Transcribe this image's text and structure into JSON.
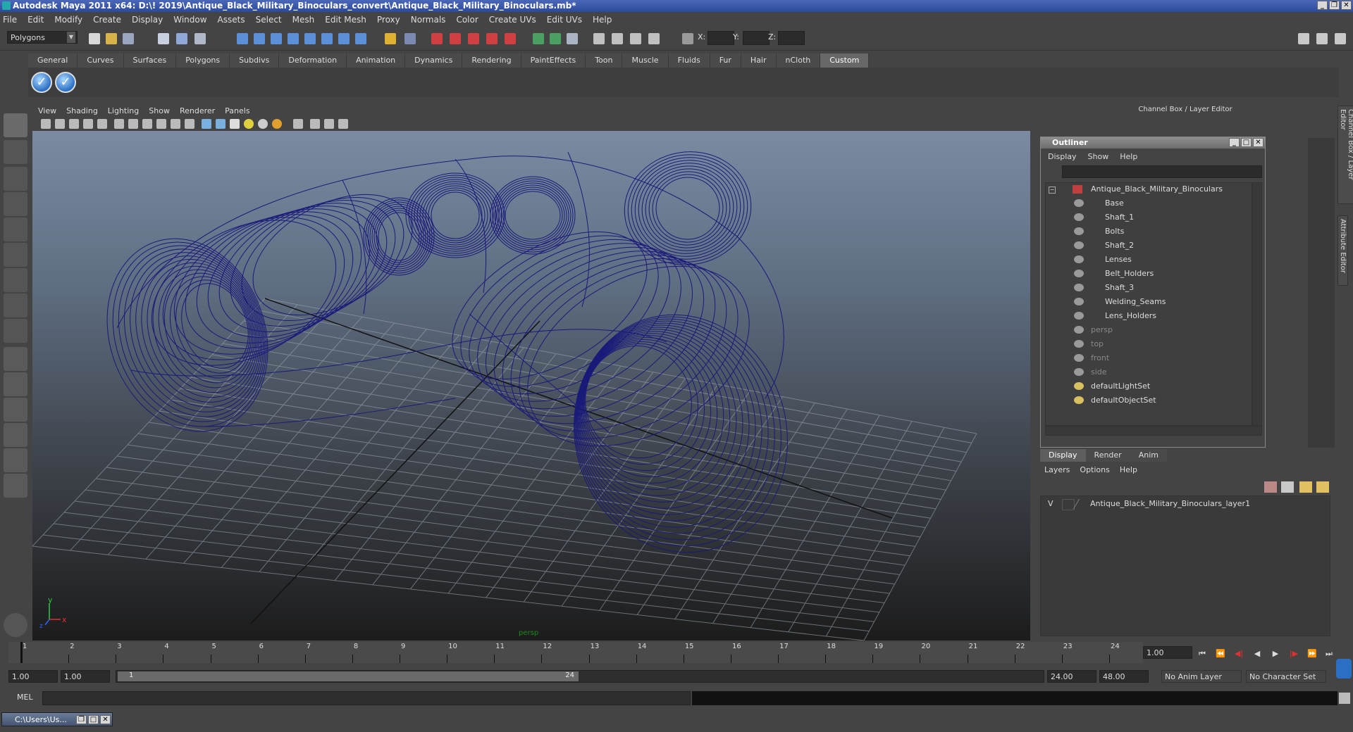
{
  "window": {
    "title": "Autodesk Maya 2011 x64: D:\\! 2019\\Antique_Black_Military_Binoculars_convert\\Antique_Black_Military_Binoculars.mb*"
  },
  "menubar": [
    "File",
    "Edit",
    "Modify",
    "Create",
    "Display",
    "Window",
    "Assets",
    "Select",
    "Mesh",
    "Edit Mesh",
    "Proxy",
    "Normals",
    "Color",
    "Create UVs",
    "Edit UVs",
    "Help"
  ],
  "statusline": {
    "mode": "Polygons",
    "x_label": "X:",
    "y_label": "Y:",
    "z_label": "Z:"
  },
  "shelf": {
    "tabs": [
      "General",
      "Curves",
      "Surfaces",
      "Polygons",
      "Subdivs",
      "Deformation",
      "Animation",
      "Dynamics",
      "Rendering",
      "PaintEffects",
      "Toon",
      "Muscle",
      "Fluids",
      "Fur",
      "Hair",
      "nCloth",
      "Custom"
    ],
    "active_tab": "Custom"
  },
  "viewport": {
    "menu": [
      "View",
      "Shading",
      "Lighting",
      "Show",
      "Renderer",
      "Panels"
    ],
    "camera_label": "persp",
    "axis_y": "y",
    "axis_x": "x",
    "axis_z": "z",
    "wire_color": "#1a1a7a"
  },
  "channelbox": {
    "title": "Channel Box / Layer Editor"
  },
  "vertical_tabs": [
    "Channel Box / Layer Editor",
    "Attribute Editor"
  ],
  "outliner": {
    "title": "Outliner",
    "menu": [
      "Display",
      "Show",
      "Help"
    ],
    "root": "Antique_Black_Military_Binoculars",
    "children": [
      "Base",
      "Shaft_1",
      "Bolts",
      "Shaft_2",
      "Lenses",
      "Belt_Holders",
      "Shaft_3",
      "Welding_Seams",
      "Lens_Holders"
    ],
    "cameras": [
      "persp",
      "top",
      "front",
      "side"
    ],
    "sets": [
      "defaultLightSet",
      "defaultObjectSet"
    ]
  },
  "layer_editor": {
    "tabs": [
      "Display",
      "Render",
      "Anim"
    ],
    "active_tab": "Display",
    "menu": [
      "Layers",
      "Options",
      "Help"
    ],
    "layer_visible": "V",
    "layer_name": "Antique_Black_Military_Binoculars_layer1"
  },
  "timeslider": {
    "start": 1,
    "end": 24,
    "current_frame": "1.00"
  },
  "range": {
    "start_time": "1.00",
    "playback_start": "1.00",
    "range_start_label": "1",
    "range_end_label": "24",
    "playback_end": "24.00",
    "end_time": "48.00",
    "anim_layer": "No Anim Layer",
    "character_set": "No Character Set"
  },
  "command": {
    "label": "MEL"
  },
  "taskbar": {
    "item": "C:\\Users\\Us..."
  }
}
